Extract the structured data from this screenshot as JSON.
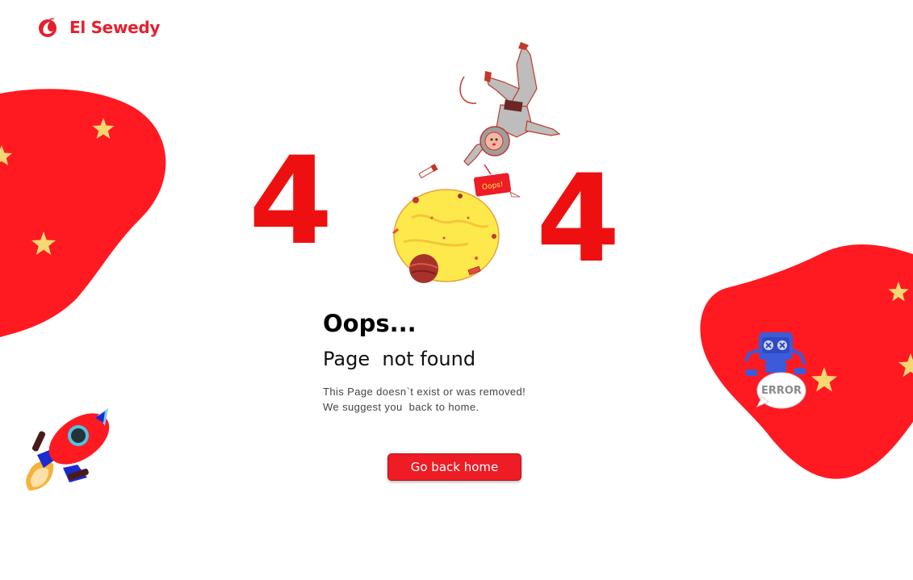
{
  "brand": {
    "name": "El Sewedy",
    "logo_icon": "el-sewedy-logo-icon",
    "color": "#e5202e"
  },
  "error": {
    "digit_left": "4",
    "digit_right": "4",
    "oops_tag": "Oops!",
    "title": "Oops...",
    "subtitle": "Page  not found",
    "line1": "This Page doesn`t exist or was removed!",
    "line2": "We suggest you  back to home."
  },
  "actions": {
    "home_button": "Go back home"
  },
  "robot": {
    "bubble_text": "ERROR"
  },
  "colors": {
    "accent_red": "#ff1a22",
    "digit_red": "#ee1010",
    "star_yellow": "#f7d774",
    "planet_yellow": "#fde94c"
  },
  "illustrations": [
    "astronaut",
    "planet",
    "rocket",
    "robot",
    "telescope"
  ]
}
